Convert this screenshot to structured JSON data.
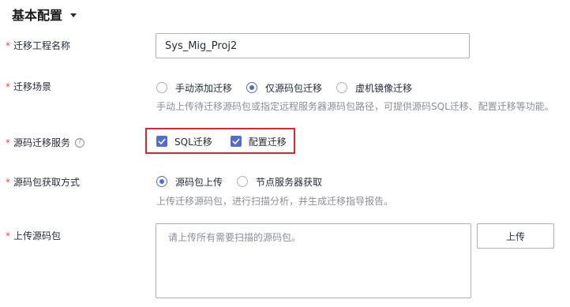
{
  "section": {
    "title": "基本配置",
    "caret_icon": "caret-down-icon"
  },
  "fields": {
    "project_name": {
      "label": "迁移工程名称",
      "value": "Sys_Mig_Proj2"
    },
    "scenario": {
      "label": "迁移场景",
      "options": [
        "手动添加迁移",
        "仅源码包迁移",
        "虚机镜像迁移"
      ],
      "selected": "仅源码包迁移",
      "hint": "手动上传待迁移源码包或指定远程服务器源码包路径，可提供源码SQL迁移、配置迁移等功能。"
    },
    "service": {
      "label": "源码迁移服务",
      "help_icon": "question-circle-icon",
      "options": [
        "SQL迁移",
        "配置迁移"
      ],
      "checked": [
        "SQL迁移",
        "配置迁移"
      ]
    },
    "source_method": {
      "label": "源码包获取方式",
      "options": [
        "源码包上传",
        "节点服务器获取"
      ],
      "selected": "源码包上传",
      "hint": "上传迁移源码包，进行扫描分析，并生成迁移指导报告。"
    },
    "upload": {
      "label": "上传源码包",
      "placeholder": "请上传所有需要扫描的源码包。",
      "button_label": "上传"
    }
  },
  "colors": {
    "primary": "#526ecc",
    "required": "#e54545",
    "highlight": "#d9272e",
    "hint": "#8a8e99",
    "border": "#adb0b8"
  }
}
